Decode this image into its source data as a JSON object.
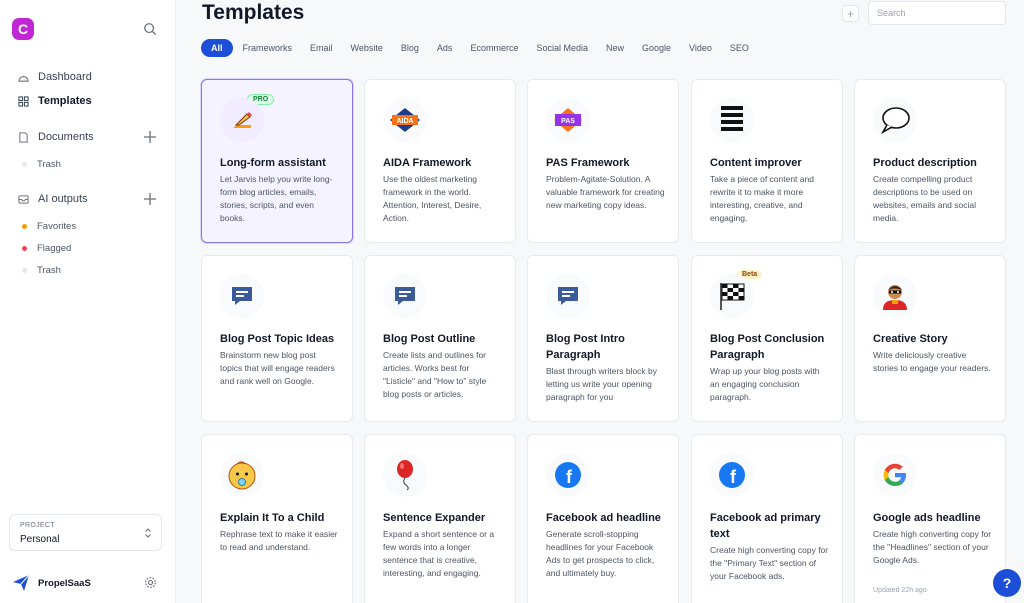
{
  "sidebar": {
    "logo_letter": "C",
    "nav": [
      {
        "label": "Dashboard",
        "icon": "dashboard-icon"
      },
      {
        "label": "Templates",
        "icon": "grid-icon"
      }
    ],
    "documents": {
      "label": "Documents",
      "icon": "document-icon",
      "items": [
        {
          "label": "Trash",
          "color": "#e5e7eb"
        }
      ]
    },
    "ai_outputs": {
      "label": "AI outputs",
      "icon": "inbox-icon",
      "items": [
        {
          "label": "Favorites",
          "color": "#f59e0b"
        },
        {
          "label": "Flagged",
          "color": "#f43f5e"
        },
        {
          "label": "Trash",
          "color": "#e5e7eb"
        }
      ]
    },
    "project": {
      "label": "PROJECT",
      "value": "Personal"
    },
    "brand": "PropelSaaS"
  },
  "header": {
    "title": "Templates",
    "add_label": "+",
    "search_placeholder": "Search"
  },
  "filters": [
    "All",
    "Frameworks",
    "Email",
    "Website",
    "Blog",
    "Ads",
    "Ecommerce",
    "Social Media",
    "New",
    "Google",
    "Video",
    "SEO"
  ],
  "active_filter": "All",
  "cards": [
    {
      "title": "Long-form assistant",
      "desc": "Let Jarvis help you write long-form blog articles, emails, stories, scripts, and even books.",
      "icon": "pencil-icon",
      "badge": "PRO"
    },
    {
      "title": "AIDA Framework",
      "desc": "Use the oldest marketing framework in the world. Attention, Interest, Desire, Action.",
      "icon": "aida-icon",
      "icon_text": "AIDA"
    },
    {
      "title": "PAS Framework",
      "desc": "Problem-Agitate-Solution. A valuable framework for creating new marketing copy ideas.",
      "icon": "pas-icon",
      "icon_text": "PAS"
    },
    {
      "title": "Content improver",
      "desc": "Take a piece of content and rewrite it to make it more interesting, creative, and engaging.",
      "icon": "lines-icon"
    },
    {
      "title": "Product description",
      "desc": "Create compelling product descriptions to be used on websites, emails and social media.",
      "icon": "speech-bubble-icon"
    },
    {
      "title": "Blog Post Topic Ideas",
      "desc": "Brainstorm new blog post topics that will engage readers and rank well on Google.",
      "icon": "message-icon"
    },
    {
      "title": "Blog Post Outline",
      "desc": "Create lists and outlines for articles. Works best for \"Listicle\" and \"How to\" style blog posts or articles.",
      "icon": "message-icon"
    },
    {
      "title": "Blog Post Intro Paragraph",
      "desc": "Blast through writers block by letting us write your opening paragraph for you",
      "icon": "message-icon"
    },
    {
      "title": "Blog Post Conclusion Paragraph",
      "desc": "Wrap up your blog posts with an engaging conclusion paragraph.",
      "icon": "checkered-flag-icon",
      "badge": "Beta"
    },
    {
      "title": "Creative Story",
      "desc": "Write deliciously creative stories to engage your readers.",
      "icon": "superhero-icon"
    },
    {
      "title": "Explain It To a Child",
      "desc": "Rephrase text to make it easier to read and understand.",
      "icon": "baby-face-icon"
    },
    {
      "title": "Sentence Expander",
      "desc": "Expand a short sentence or a few words into a longer sentence that is creative, interesting, and engaging.",
      "icon": "balloon-icon"
    },
    {
      "title": "Facebook ad headline",
      "desc": "Generate scroll-stopping headlines for your Facebook Ads to get prospects to click, and ultimately buy.",
      "icon": "facebook-icon",
      "icon_text": "f"
    },
    {
      "title": "Facebook ad primary text",
      "desc": "Create high converting copy for the \"Primary Text\" section of your Facebook ads.",
      "icon": "facebook-icon",
      "icon_text": "f"
    },
    {
      "title": "Google ads headline",
      "desc": "Create high converting copy for the \"Headlines\" section of your Google Ads.",
      "icon": "google-icon",
      "icon_text": "G",
      "updated": "Updated 22h ago"
    }
  ],
  "help_label": "?",
  "colors": {
    "accent": "#1d4ed8",
    "logo": "#c026d3",
    "selected_border": "#8b74e6"
  }
}
